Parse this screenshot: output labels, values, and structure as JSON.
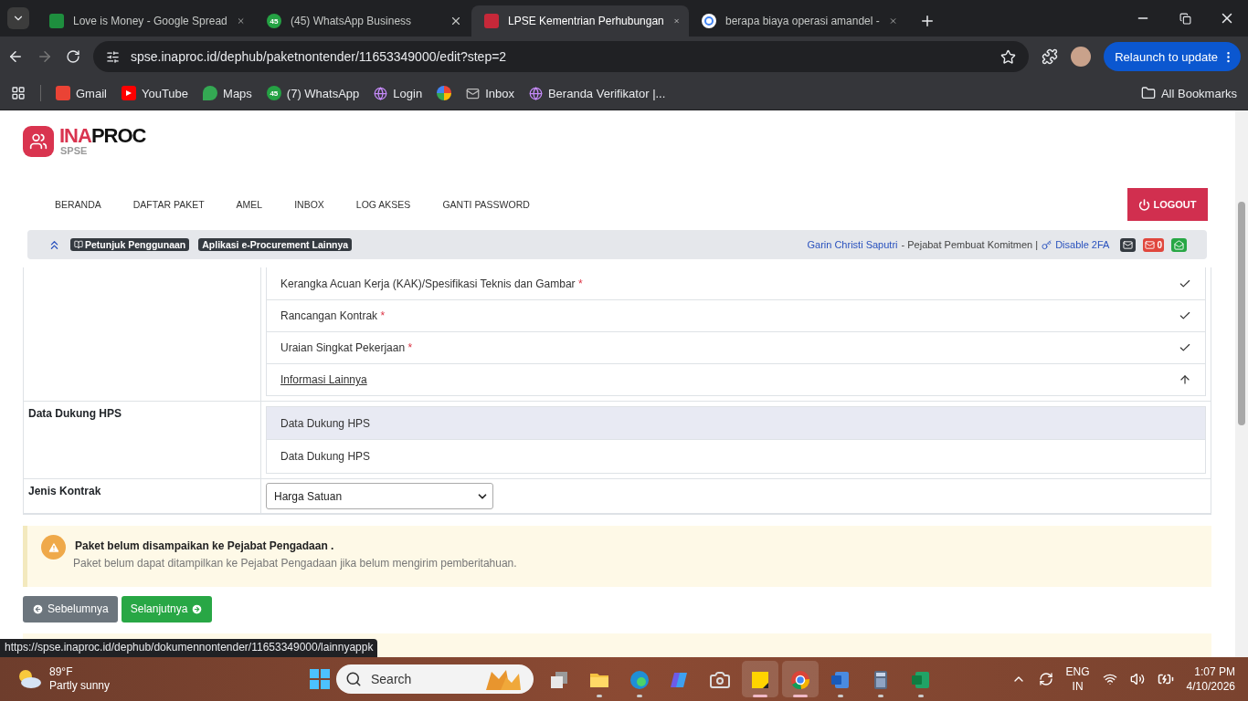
{
  "browser": {
    "tabs": [
      {
        "title": "Love is Money - Google Spread",
        "kind": "sheets",
        "selected": false
      },
      {
        "title": "(45) WhatsApp Business",
        "kind": "whatsapp",
        "badge": "45",
        "selected": false
      },
      {
        "title": "LPSE Kementrian Perhubungan",
        "kind": "lpse",
        "selected": true
      },
      {
        "title": "berapa biaya operasi amandel -",
        "kind": "google",
        "selected": false
      }
    ],
    "address": "spse.inaproc.id/dephub/paketnontender/11653349000/edit?step=2",
    "relaunch": "Relaunch to update",
    "bookmarks": [
      {
        "label": "Gmail",
        "kind": "gmail"
      },
      {
        "label": "YouTube",
        "kind": "youtube"
      },
      {
        "label": "Maps",
        "kind": "maps"
      },
      {
        "label": "(7) WhatsApp",
        "kind": "whatsapp",
        "badge": "45"
      },
      {
        "label": "Login",
        "kind": "globe"
      },
      {
        "kind": "photos"
      },
      {
        "label": "Inbox",
        "kind": "mail"
      },
      {
        "label": "Beranda Verifikator |...",
        "kind": "globe"
      }
    ],
    "all_bookmarks": "All Bookmarks",
    "status_url": "https://spse.inaproc.id/dephub/dokumennontender/11653349000/lainnyappk"
  },
  "header": {
    "logo": {
      "prefix": "INA",
      "name": "PROC",
      "sub": "SPSE"
    },
    "nav": [
      "BERANDA",
      "DAFTAR PAKET",
      "AMEL",
      "INBOX",
      "LOG AKSES",
      "GANTI PASSWORD"
    ],
    "logout": "LOGOUT"
  },
  "infobar": {
    "badges": [
      "Petunjuk Penggunaan",
      "Aplikasi e-Procurement Lainnya"
    ],
    "user": "Garin Christi Saputri",
    "role": "- Pejabat Pembuat Komitmen |",
    "twofa": "Disable 2FA",
    "mail_count": "0"
  },
  "form": {
    "required_mark": "*",
    "checklist": [
      {
        "label": "Kerangka Acuan Kerja (KAK)/Spesifikasi Teknis dan Gambar",
        "required": true,
        "checked": true
      },
      {
        "label": "Rancangan Kontrak",
        "required": true,
        "checked": true
      },
      {
        "label": "Uraian Singkat Pekerjaan",
        "required": true,
        "checked": true
      },
      {
        "label": "Informasi Lainnya",
        "required": false,
        "checked": false
      }
    ],
    "hps": {
      "label": "Data Dukung HPS",
      "panel_title": "Data Dukung HPS",
      "panel_body": "Data Dukung HPS"
    },
    "contract": {
      "label": "Jenis Kontrak",
      "value": "Harga Satuan"
    }
  },
  "alert": {
    "title": "Paket belum disampaikan ke Pejabat Pengadaan .",
    "body": "Paket belum dapat ditampilkan ke Pejabat Pengadaan jika belum mengirim pemberitahuan."
  },
  "buttons": {
    "prev": "Sebelumnya",
    "next": "Selanjutnya"
  },
  "taskbar": {
    "weather": {
      "temp": "89°F",
      "desc": "Partly sunny"
    },
    "search": "Search",
    "apps": [
      {
        "kind": "taskview",
        "open": false,
        "active": false
      },
      {
        "kind": "folder",
        "open": true,
        "active": false
      },
      {
        "kind": "edge",
        "open": true,
        "active": false
      },
      {
        "kind": "copilot",
        "open": false,
        "active": false
      },
      {
        "kind": "camera",
        "open": false,
        "active": false
      },
      {
        "kind": "notes",
        "open": true,
        "active": true
      },
      {
        "kind": "chrome",
        "open": true,
        "active": true
      },
      {
        "kind": "word",
        "open": true,
        "active": false
      },
      {
        "kind": "calculator",
        "open": true,
        "active": false
      },
      {
        "kind": "excel",
        "open": true,
        "active": false
      }
    ],
    "lang": "ENG",
    "region": "IN",
    "time": "1:07 PM",
    "date": "4/10/2026"
  }
}
